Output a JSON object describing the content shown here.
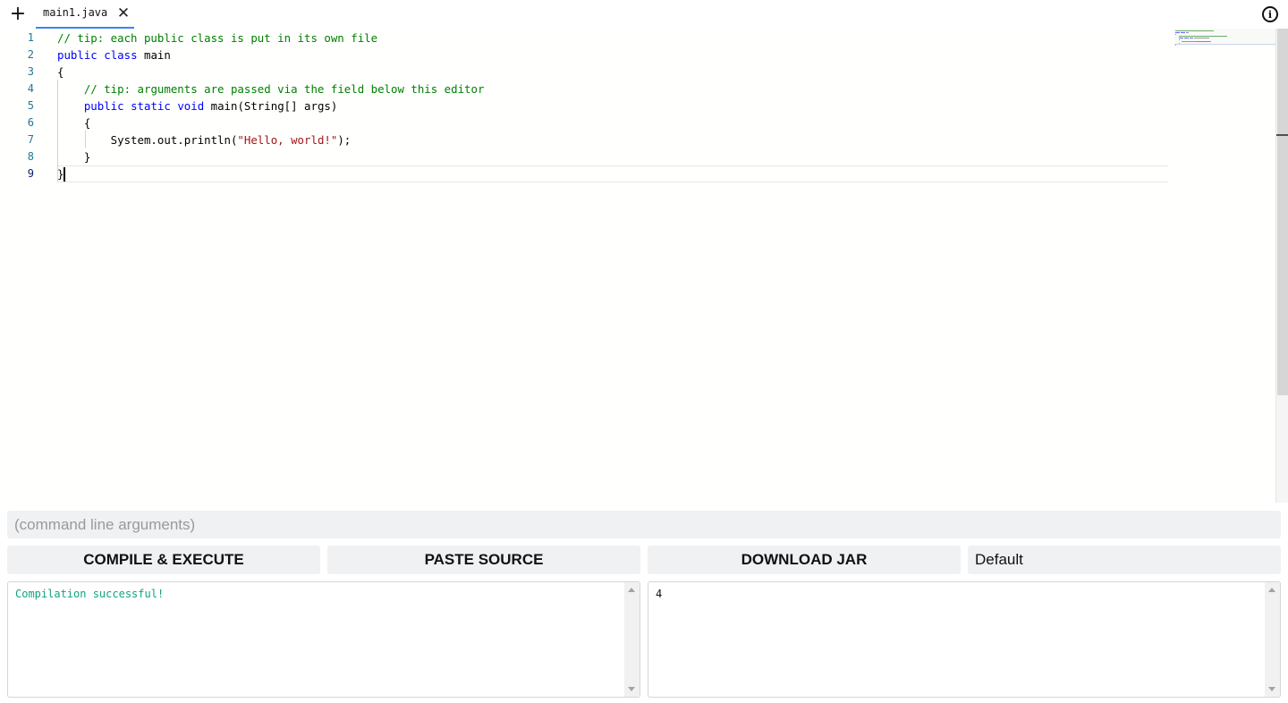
{
  "tabs": [
    {
      "label": "main1.java",
      "active": true
    }
  ],
  "icons": {
    "add_tab": "+",
    "close_tab": "✕",
    "info": "i"
  },
  "editor": {
    "line_numbers": [
      "1",
      "2",
      "3",
      "4",
      "5",
      "6",
      "7",
      "8",
      "9"
    ],
    "active_line": 9,
    "lines": [
      [
        {
          "t": "// tip: each public class is put in its own file",
          "c": "cm"
        }
      ],
      [
        {
          "t": "public",
          "c": "kw"
        },
        {
          "t": " "
        },
        {
          "t": "class",
          "c": "kw"
        },
        {
          "t": " main"
        }
      ],
      [
        {
          "t": "{"
        }
      ],
      [
        {
          "t": "    "
        },
        {
          "t": "// tip: arguments are passed via the field below this editor",
          "c": "cm"
        }
      ],
      [
        {
          "t": "    "
        },
        {
          "t": "public",
          "c": "kw"
        },
        {
          "t": " "
        },
        {
          "t": "static",
          "c": "kw"
        },
        {
          "t": " "
        },
        {
          "t": "void",
          "c": "kw"
        },
        {
          "t": " main(String[] args)"
        }
      ],
      [
        {
          "t": "    {"
        }
      ],
      [
        {
          "t": "        System.out.println("
        },
        {
          "t": "\"Hello, world!\"",
          "c": "str"
        },
        {
          "t": ");"
        }
      ],
      [
        {
          "t": "    }"
        }
      ],
      [
        {
          "t": "}"
        }
      ]
    ]
  },
  "args_input": {
    "value": "",
    "placeholder": "(command line arguments)"
  },
  "buttons": {
    "compile": "COMPILE & EXECUTE",
    "paste": "PASTE SOURCE",
    "download": "DOWNLOAD JAR"
  },
  "select": {
    "value": "Default"
  },
  "output": {
    "compile_text": "Compilation successful!",
    "compile_color": "#10a37f",
    "run_text": "4"
  },
  "colors": {
    "keyword": "#0000ff",
    "comment": "#008000",
    "string": "#a31515",
    "line_number": "#237893",
    "tab_underline": "#3b82f6"
  }
}
